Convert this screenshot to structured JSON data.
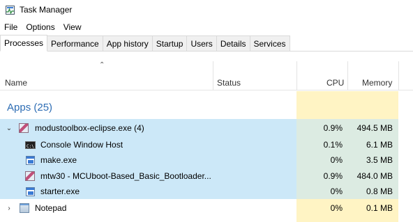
{
  "window": {
    "title": "Task Manager"
  },
  "menu": [
    "File",
    "Options",
    "View"
  ],
  "tabs": [
    "Processes",
    "Performance",
    "App history",
    "Startup",
    "Users",
    "Details",
    "Services"
  ],
  "active_tab": "Processes",
  "columns": {
    "name": "Name",
    "status": "Status",
    "cpu": "CPU",
    "memory": "Memory"
  },
  "groups": {
    "apps_label": "Apps (25)"
  },
  "rows": [
    {
      "name": "modustoolbox-eclipse.exe (4)",
      "status": "",
      "cpu": "0.9%",
      "memory": "494.5 MB",
      "icon": "eclipse-icon",
      "expander": "chevron-down"
    },
    {
      "name": "Console Window Host",
      "status": "",
      "cpu": "0.1%",
      "memory": "6.1 MB",
      "icon": "console-icon"
    },
    {
      "name": "make.exe",
      "status": "",
      "cpu": "0%",
      "memory": "3.5 MB",
      "icon": "window-icon"
    },
    {
      "name": "mtw30 - MCUboot-Based_Basic_Bootloader...",
      "status": "",
      "cpu": "0.9%",
      "memory": "484.0 MB",
      "icon": "eclipse-icon"
    },
    {
      "name": "starter.exe",
      "status": "",
      "cpu": "0%",
      "memory": "0.8 MB",
      "icon": "window-icon"
    },
    {
      "name": "Notepad",
      "status": "",
      "cpu": "0%",
      "memory": "0.1 MB",
      "icon": "notepad-icon",
      "expander": "chevron-right"
    }
  ],
  "colors": {
    "accent": "#2e6db4",
    "selection": "#cce8f8",
    "heat": "#fff4c4"
  }
}
